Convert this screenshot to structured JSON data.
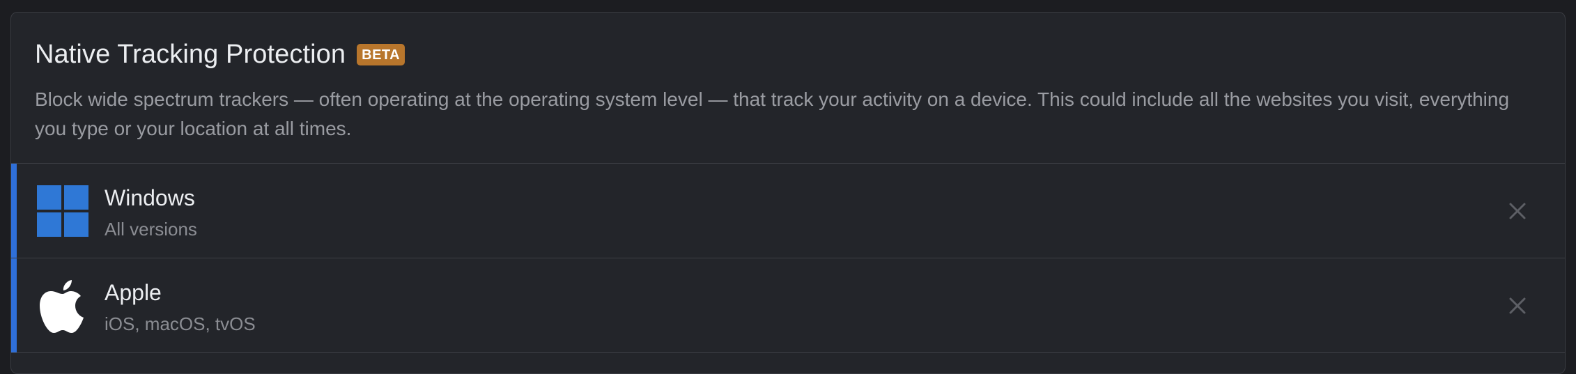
{
  "section": {
    "title": "Native Tracking Protection",
    "badge": "BETA",
    "description": "Block wide spectrum trackers — often operating at the operating system level — that track your activity on a device. This could include all the websites you visit, everything you type or your location at all times."
  },
  "items": [
    {
      "name": "Windows",
      "subtitle": "All versions",
      "icon": "windows-logo-icon",
      "remove_icon": "close-icon"
    },
    {
      "name": "Apple",
      "subtitle": "iOS, macOS, tvOS",
      "icon": "apple-logo-icon",
      "remove_icon": "close-icon"
    }
  ],
  "colors": {
    "background": "#1c1d21",
    "card": "#23252a",
    "accent": "#2f6fd8",
    "badge": "#b8762c",
    "windows_logo": "#2f78d6"
  }
}
